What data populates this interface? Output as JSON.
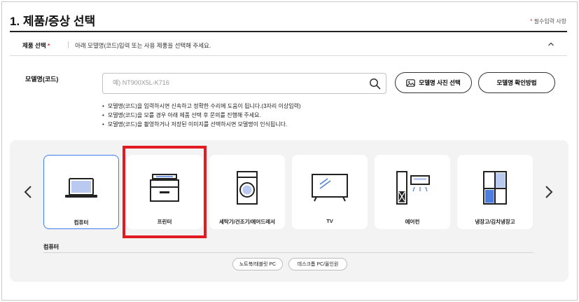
{
  "header": {
    "title": "1. 제품/증상 선택",
    "required_star": "*",
    "required_text": " 필수입력 사항"
  },
  "section": {
    "label": "제품 선택",
    "star": "*",
    "description": "아래 모델명(코드)입력 또는 사용 제품을 선택해 주세요."
  },
  "model": {
    "label": "모델명(코드)",
    "placeholder": "예) NT900X5L-K716",
    "value": "",
    "photo_button": "모델명 사진 선택",
    "howto_button": "모델명 확인방법"
  },
  "notes": [
    "모델명(코드)을 입력하시면 신속하고 정확한 수리에 도움이 됩니다.(3자리 이상입력)",
    "모델명(코드)을 모를 경우 아래 제품 선택 후 문의를 진행해 주세요.",
    "모델명(코드)을 촬영하거나 저장된 이미지를 선택하시면 모델명이 인식됩니다."
  ],
  "products": [
    {
      "label": "컴퓨터",
      "icon": "laptop-icon",
      "selected": true
    },
    {
      "label": "프린터",
      "icon": "printer-icon",
      "selected": false
    },
    {
      "label": "세탁기/건조기/에어드레서",
      "icon": "washing-machine-icon",
      "selected": false
    },
    {
      "label": "TV",
      "icon": "tv-icon",
      "selected": false
    },
    {
      "label": "에어컨",
      "icon": "air-conditioner-icon",
      "selected": false
    },
    {
      "label": "냉장고/김치냉장고",
      "icon": "refrigerator-icon",
      "selected": false
    }
  ],
  "category": {
    "title": "컴퓨터",
    "subs": [
      "노트북/태블릿 PC",
      "데스크톱 PC/올인원"
    ]
  },
  "colors": {
    "accent": "#3d7df0",
    "required": "#e0262d",
    "highlight": "#e21b23",
    "panel": "#f3f3f3",
    "icon_blue": "#4e7de0"
  }
}
